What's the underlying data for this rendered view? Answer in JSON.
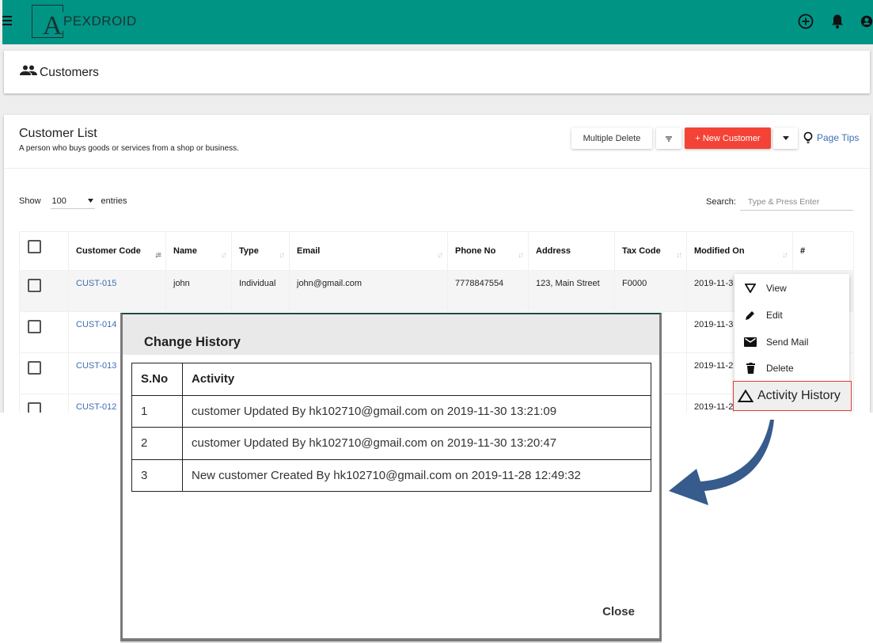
{
  "app": {
    "logo_letter": "A",
    "logo_text": "PEXDROID",
    "brand_color": "#009485"
  },
  "topbar": {
    "icons": [
      "menu-icon",
      "add-circle-icon",
      "bell-icon",
      "account-icon"
    ]
  },
  "breadcrumb": {
    "icon": "people-icon",
    "title": "Customers"
  },
  "card": {
    "title": "Customer List",
    "subtitle": "A person who buys goods or services from a shop or business.",
    "buttons": {
      "multiple_delete": "Multiple Delete",
      "new_customer": "+ New Customer",
      "page_tips": "Page Tips"
    },
    "accent_color": "#f44336"
  },
  "list_controls": {
    "show_label": "Show",
    "entries_value": "100",
    "entries_label": "entries",
    "search_label": "Search:",
    "search_placeholder": "Type & Press Enter"
  },
  "table": {
    "columns": [
      "Customer Code",
      "Name",
      "Type",
      "Email",
      "Phone No",
      "Address",
      "Tax Code",
      "Modified On",
      "#"
    ],
    "rows": [
      {
        "code": "CUST-015",
        "name": "john",
        "type": "Individual",
        "email": "john@gmail.com",
        "phone": "7778847554",
        "address": "123, Main Street",
        "tax": "F0000",
        "modified": "2019-11-3"
      },
      {
        "code": "CUST-014",
        "name": "",
        "type": "",
        "email": "",
        "phone": "",
        "address": "",
        "tax": "",
        "modified": "2019-11-3"
      },
      {
        "code": "CUST-013",
        "name": "",
        "type": "",
        "email": "",
        "phone": "",
        "address": "",
        "tax": "",
        "modified": "2019-11-2"
      },
      {
        "code": "CUST-012",
        "name": "",
        "type": "",
        "email": "",
        "phone": "",
        "address": "",
        "tax": "",
        "modified": "2019-11-2"
      }
    ]
  },
  "action_menu": {
    "items": [
      {
        "label": "View",
        "icon": "filter-triangle-icon"
      },
      {
        "label": "Edit",
        "icon": "pencil-icon"
      },
      {
        "label": "Send Mail",
        "icon": "mail-icon"
      },
      {
        "label": "Delete",
        "icon": "trash-icon"
      },
      {
        "label": "Activity History",
        "icon": "triangle-icon",
        "highlighted": true
      }
    ]
  },
  "modal": {
    "title": "Change History",
    "columns": [
      "S.No",
      "Activity"
    ],
    "rows": [
      {
        "sno": "1",
        "activity": "customer Updated By hk102710@gmail.com on 2019-11-30 13:21:09"
      },
      {
        "sno": "2",
        "activity": "customer Updated By hk102710@gmail.com on 2019-11-30 13:20:47"
      },
      {
        "sno": "3",
        "activity": "New customer Created By hk102710@gmail.com on 2019-11-28 12:49:32"
      }
    ],
    "close_label": "Close"
  },
  "annotation": {
    "arrow_color": "#365b8c"
  }
}
